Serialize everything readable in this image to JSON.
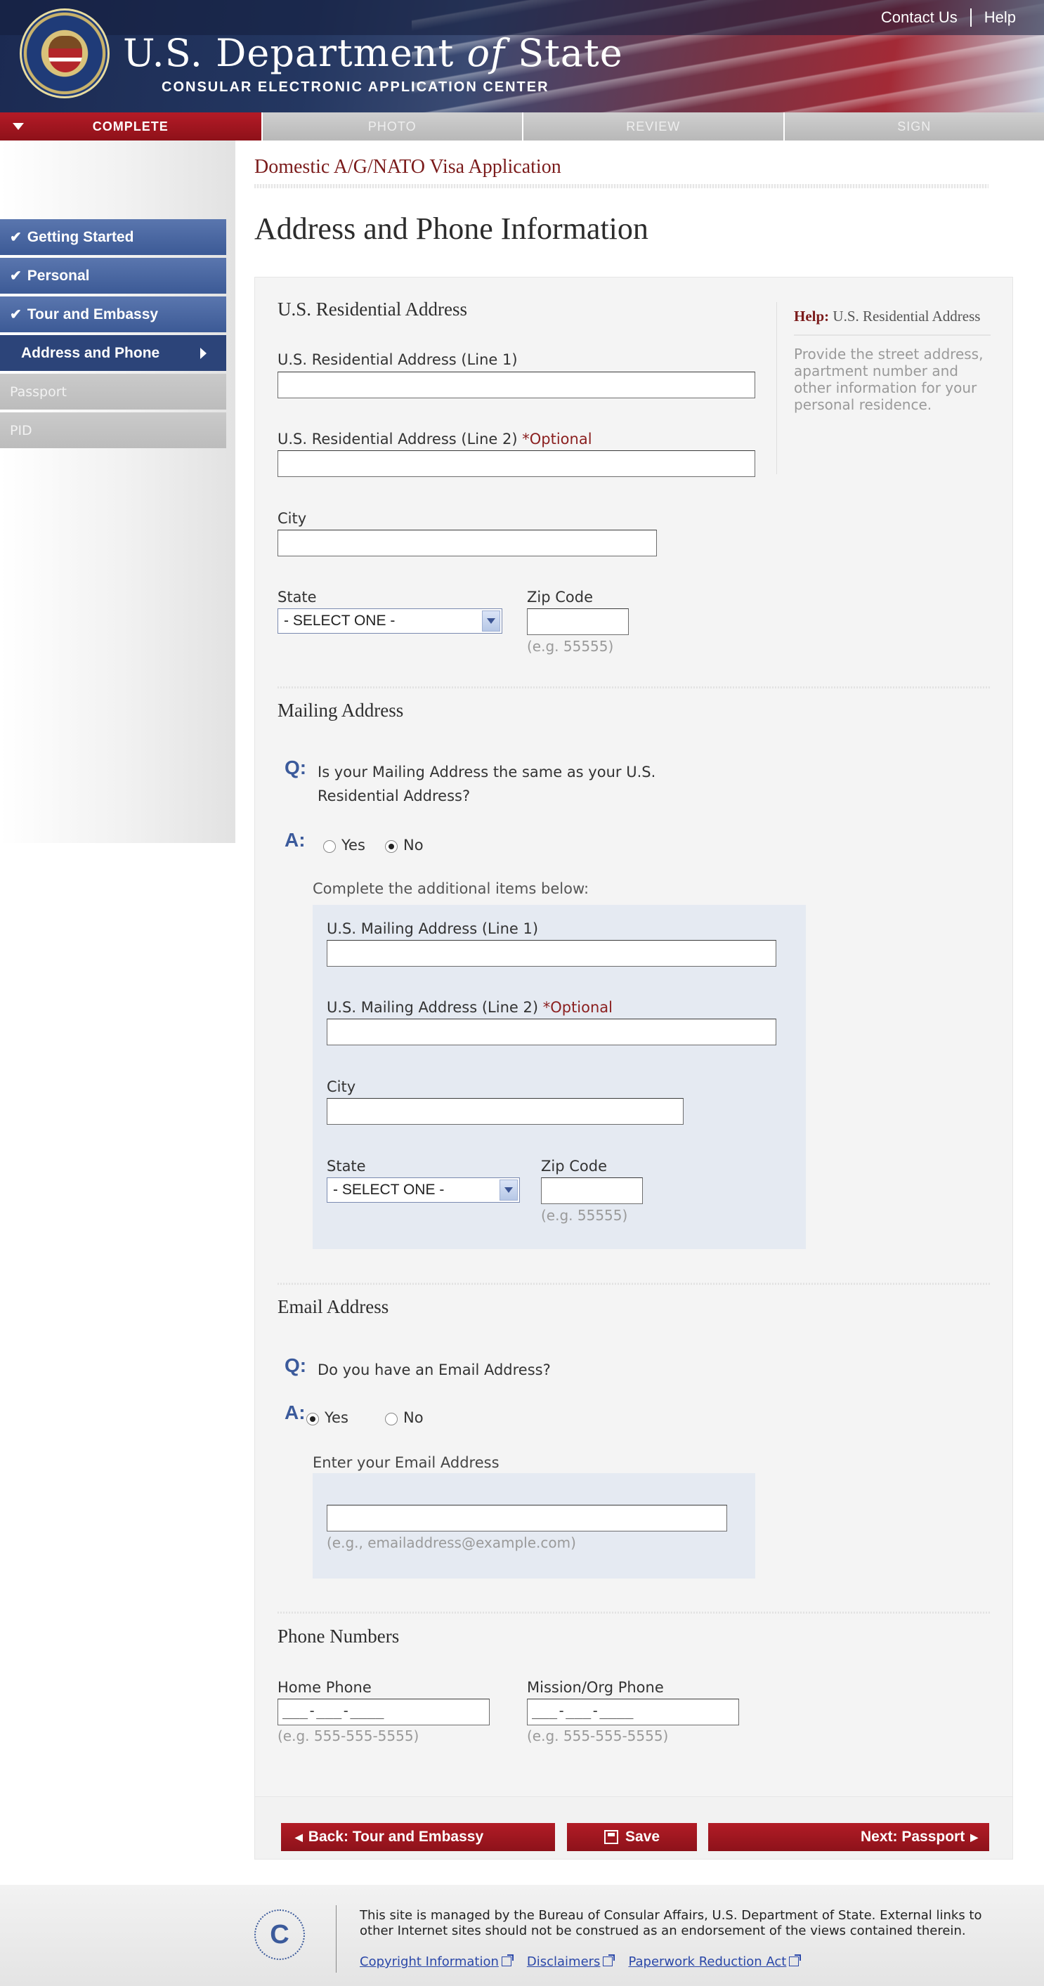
{
  "header": {
    "dept_title_prefix": "U.S. Department ",
    "dept_title_of": "of",
    "dept_title_suffix": " State",
    "dept_subtitle": "CONSULAR ELECTRONIC APPLICATION CENTER",
    "links": [
      "Contact Us",
      "Help"
    ]
  },
  "progress": {
    "steps": [
      "COMPLETE",
      "PHOTO",
      "REVIEW",
      "SIGN"
    ],
    "active_index": 0
  },
  "sidebar": {
    "items": [
      {
        "label": "Getting Started",
        "state": "done"
      },
      {
        "label": "Personal",
        "state": "done"
      },
      {
        "label": "Tour and Embassy",
        "state": "done"
      },
      {
        "label": "Address and Phone",
        "state": "current"
      },
      {
        "label": "Passport",
        "state": "todo"
      },
      {
        "label": "PID",
        "state": "todo"
      }
    ]
  },
  "main": {
    "application_title": "Domestic A/G/NATO Visa Application",
    "page_title": "Address and Phone Information"
  },
  "residential": {
    "section_title": "U.S. Residential Address",
    "line1_label": "U.S. Residential Address (Line 1)",
    "line1_value": "",
    "line2_label": "U.S. Residential Address (Line 2) ",
    "line2_optional": "*Optional",
    "line2_value": "",
    "city_label": "City",
    "city_value": "",
    "state_label": "State",
    "state_selected": "- SELECT ONE -",
    "zip_label": "Zip Code",
    "zip_value": "",
    "zip_hint": "(e.g. 55555)"
  },
  "help": {
    "prefix": "Help:",
    "title": "U.S. Residential Address",
    "body": "Provide the street address, apartment number and other information for your personal residence."
  },
  "mailing": {
    "section_title": "Mailing Address",
    "q_marker": "Q:",
    "a_marker": "A:",
    "question": "Is your Mailing Address the same as your U.S. Residential Address?",
    "yes_label": "Yes",
    "no_label": "No",
    "selected": "No",
    "instruction": "Complete the additional items below:",
    "line1_label": "U.S. Mailing Address (Line 1)",
    "line1_value": "",
    "line2_label": "U.S. Mailing Address (Line 2) ",
    "line2_optional": "*Optional",
    "line2_value": "",
    "city_label": "City",
    "city_value": "",
    "state_label": "State",
    "state_selected": "- SELECT ONE -",
    "zip_label": "Zip Code",
    "zip_value": "",
    "zip_hint": "(e.g. 55555)"
  },
  "email": {
    "section_title": "Email Address",
    "q_marker": "Q:",
    "a_marker": "A:",
    "question": "Do you have an Email Address?",
    "yes_label": "Yes",
    "no_label": "No",
    "selected": "Yes",
    "instruction": "Enter your Email Address",
    "value": "",
    "hint": "(e.g., emailaddress@example.com)"
  },
  "phone": {
    "section_title": "Phone Numbers",
    "home_label": "Home Phone",
    "home_value": "___-___-____",
    "home_hint": "(e.g. 555-555-5555)",
    "mission_label": "Mission/Org Phone",
    "mission_value": "___-___-____",
    "mission_hint": "(e.g. 555-555-5555)"
  },
  "buttons": {
    "back_label": "Back: Tour and Embassy",
    "save_label": "Save",
    "next_label": "Next: Passport"
  },
  "footer": {
    "logo_letter": "C",
    "text": "This site is managed by the Bureau of Consular Affairs, U.S. Department of State. External links to other Internet sites should not be construed as an endorsement of the views contained therein.",
    "links": [
      "Copyright Information",
      "Disclaimers",
      "Paperwork Reduction Act"
    ]
  },
  "colors": {
    "brand_red": "#a3161f",
    "nav_blue": "#3c5a96",
    "nav_current": "#2c4479",
    "accent_text_red": "#7b1b1b",
    "subbox_blue": "#e5eaf2"
  }
}
